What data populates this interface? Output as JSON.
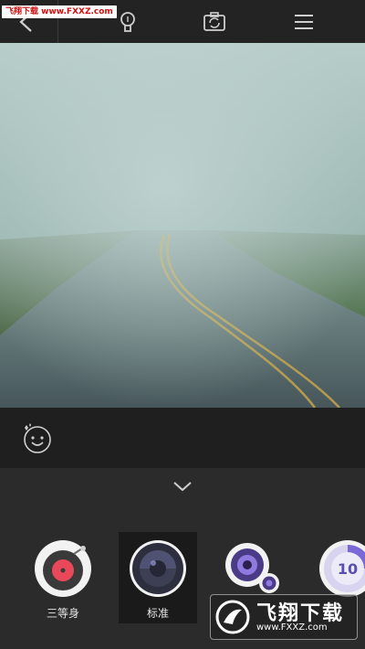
{
  "watermark_top": "飞翔下载 www.FXXZ.com",
  "topbar": {
    "icons": [
      "back-arrow-icon",
      "lightbulb-icon",
      "switch-camera-icon",
      "menu-icon"
    ]
  },
  "viewfinder": {
    "scene": "foggy-road-photo"
  },
  "beauty": {
    "icon": "beauty-face-icon"
  },
  "panel": {
    "collapse_icon": "chevron-down-icon",
    "modes": [
      {
        "label": "三等身",
        "icon": "record-disc-icon",
        "selected": false
      },
      {
        "label": "标准",
        "icon": "lens-icon",
        "selected": true
      },
      {
        "label": "",
        "icon": "dual-lens-icon",
        "selected": false
      },
      {
        "label": "",
        "icon": "timer-10-icon",
        "selected": false
      }
    ],
    "timer_number": "10"
  },
  "watermark_bottom": {
    "title": "飞翔下载",
    "url": "www.FXXZ.com"
  }
}
